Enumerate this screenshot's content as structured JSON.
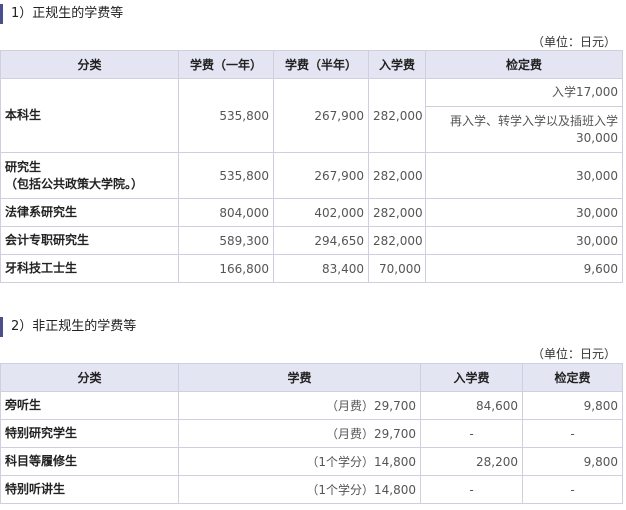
{
  "section1": {
    "title": "1）正规生的学费等",
    "unit": "（单位：日元）",
    "headers": [
      "分类",
      "学费（一年）",
      "学费（半年）",
      "入学费",
      "检定费"
    ],
    "rows": [
      {
        "category": "本科生",
        "tuition_year": "535,800",
        "tuition_half": "267,900",
        "admission": "282,000",
        "exam_1": "入学17,000",
        "exam_2_note": "再入学、转学入学以及插班入学",
        "exam_2_value": "30,000"
      },
      {
        "category": "研究生\n（包括公共政策大学院。）",
        "tuition_year": "535,800",
        "tuition_half": "267,900",
        "admission": "282,000",
        "exam": "30,000"
      },
      {
        "category": "法律系研究生",
        "tuition_year": "804,000",
        "tuition_half": "402,000",
        "admission": "282,000",
        "exam": "30,000"
      },
      {
        "category": "会计专职研究生",
        "tuition_year": "589,300",
        "tuition_half": "294,650",
        "admission": "282,000",
        "exam": "30,000"
      },
      {
        "category": "牙科技工士生",
        "tuition_year": "166,800",
        "tuition_half": "83,400",
        "admission": "70,000",
        "exam": "9,600"
      }
    ]
  },
  "section2": {
    "title": "2）非正规生的学费等",
    "unit": "（单位：日元）",
    "headers": [
      "分类",
      "学费",
      "入学费",
      "检定费"
    ],
    "rows": [
      {
        "category": "旁听生",
        "tuition": "（月费）29,700",
        "admission": "84,600",
        "exam": "9,800"
      },
      {
        "category": "特别研究学生",
        "tuition": "（月费）29,700",
        "admission": "-",
        "exam": "-"
      },
      {
        "category": "科目等履修生",
        "tuition": "（1个学分）14,800",
        "admission": "28,200",
        "exam": "9,800"
      },
      {
        "category": "特别听讲生",
        "tuition": "（1个学分）14,800",
        "admission": "-",
        "exam": "-"
      }
    ]
  }
}
